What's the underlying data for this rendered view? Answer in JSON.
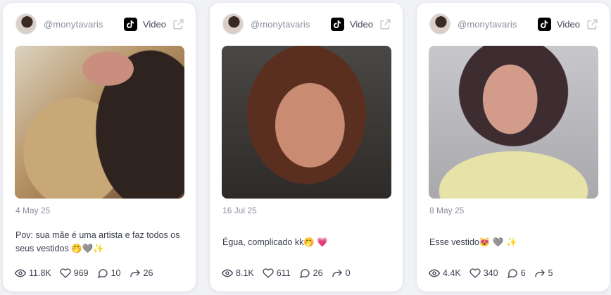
{
  "posts": [
    {
      "handle": "@monytavaris",
      "type_label": "Video",
      "date": "4 May 25",
      "caption": "Pov: sua mãe é uma artista e faz todos os seus vestidos 🤭🩶✨",
      "views": "11.8K",
      "likes": "969",
      "comments": "10",
      "shares": "26"
    },
    {
      "handle": "@monytavaris",
      "type_label": "Video",
      "date": "16 Jul 25",
      "caption": "Égua, complicado kk🤭 💗",
      "views": "8.1K",
      "likes": "611",
      "comments": "26",
      "shares": "0"
    },
    {
      "handle": "@monytavaris",
      "type_label": "Video",
      "date": "8 May 25",
      "caption": "Esse vestido😻 🩶 ✨",
      "views": "4.4K",
      "likes": "340",
      "comments": "6",
      "shares": "5"
    }
  ],
  "icons": {
    "platform": "tiktok-icon",
    "external": "external-link-icon",
    "views": "eye-icon",
    "likes": "heart-icon",
    "comments": "comment-icon",
    "shares": "share-icon"
  }
}
